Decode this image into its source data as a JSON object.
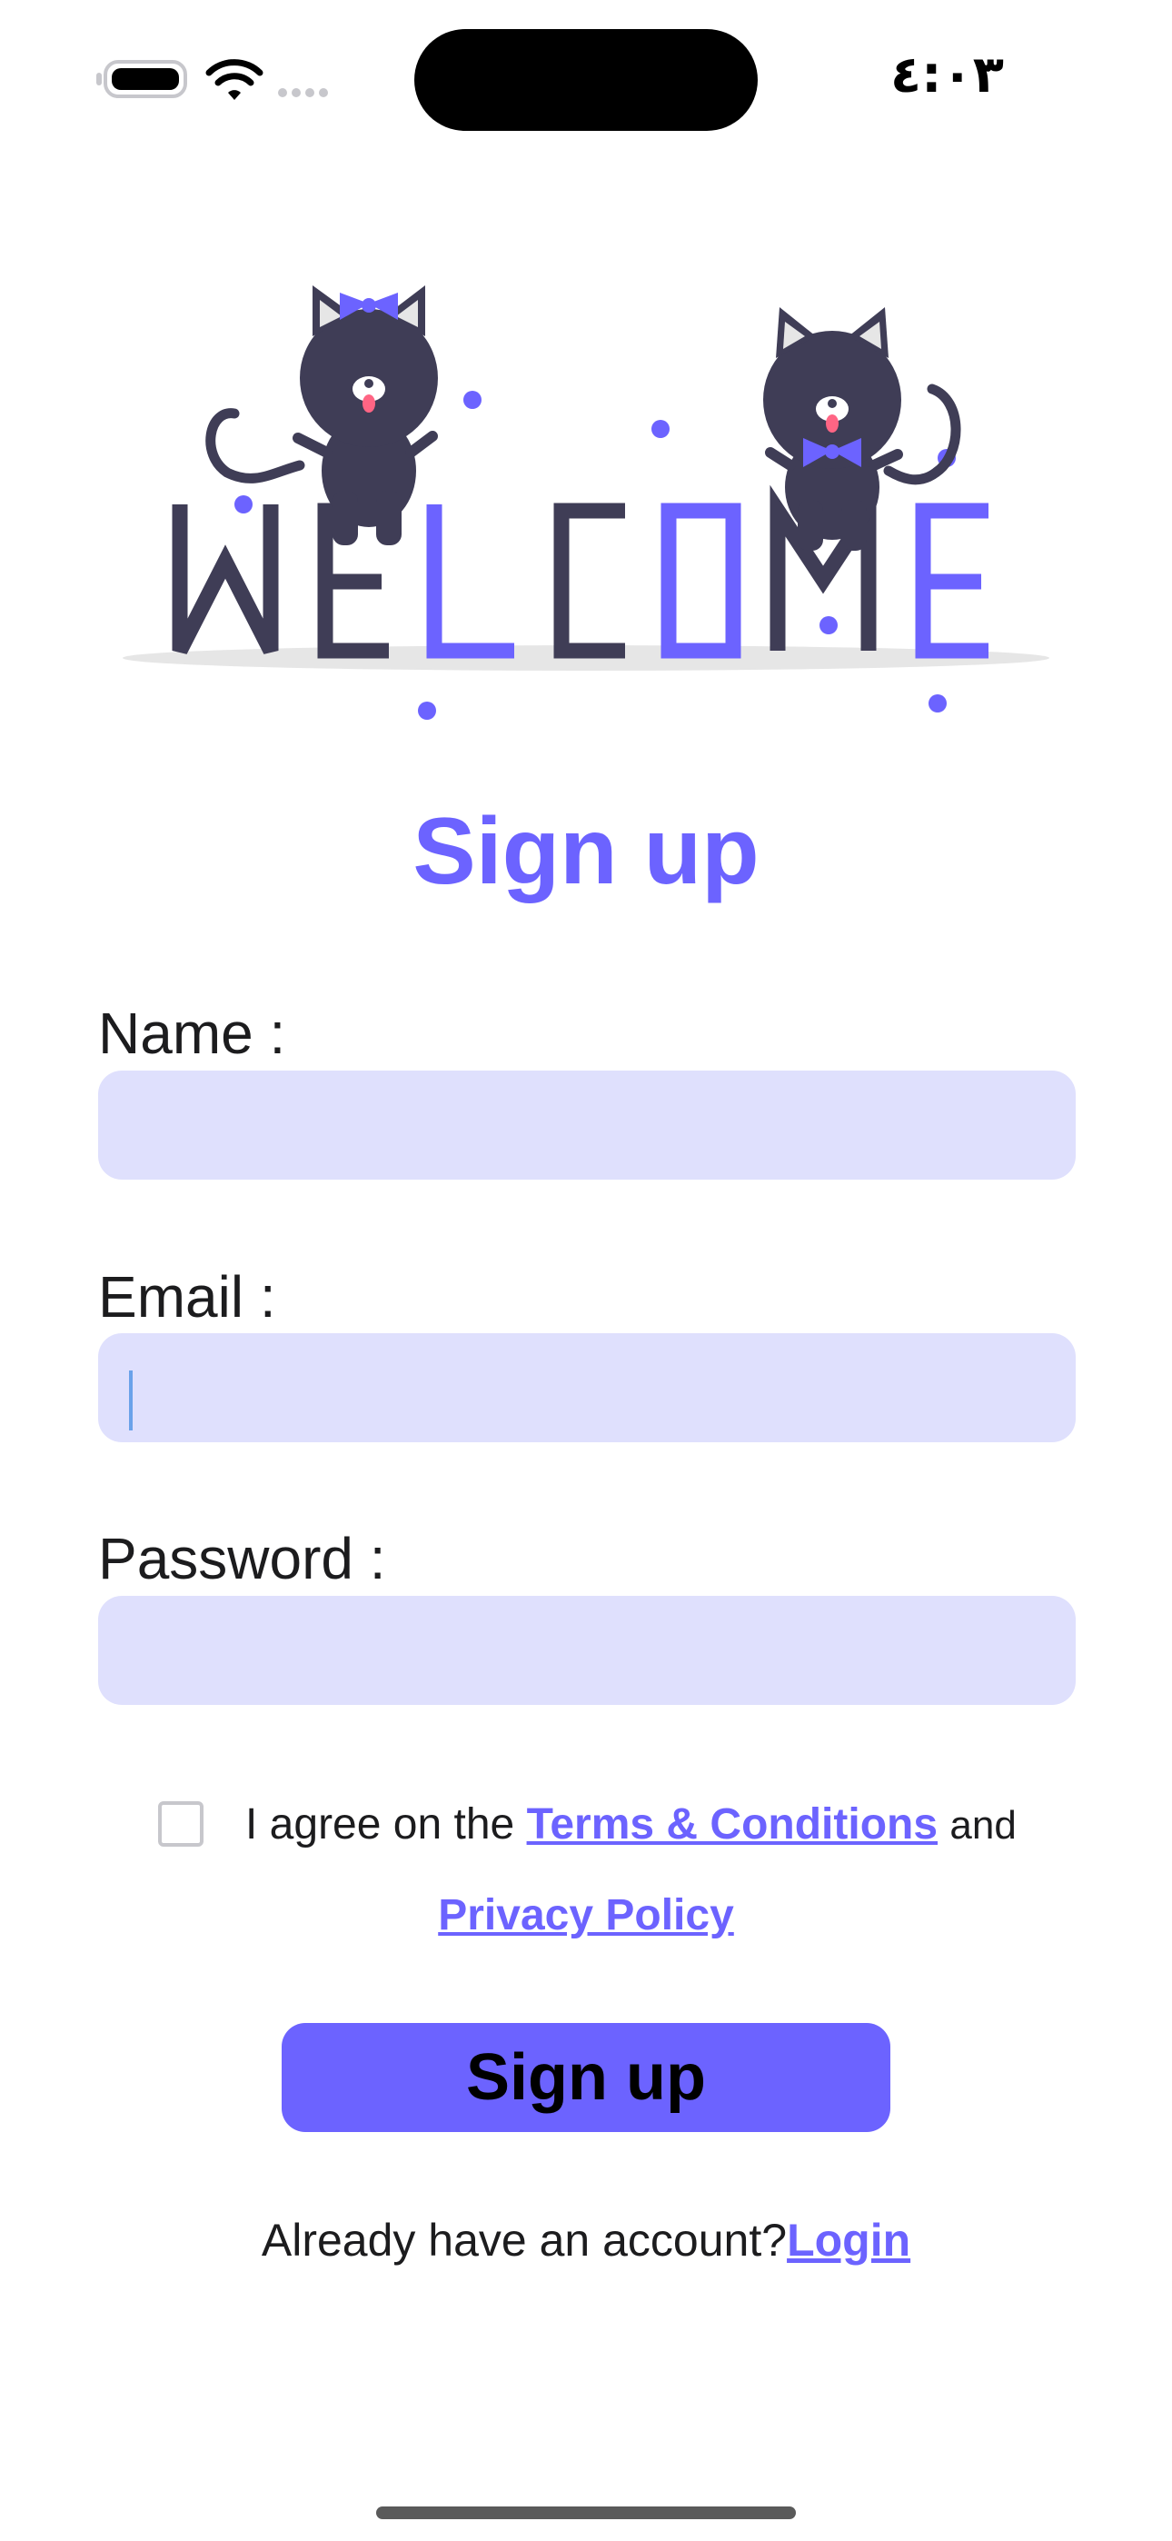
{
  "status_bar": {
    "time": "٤:٠٣",
    "icons": [
      "battery-icon",
      "wifi-icon",
      "cellular-icon"
    ]
  },
  "hero": {
    "illustration": "welcome-cats-illustration",
    "welcome_letters": [
      "W",
      "E",
      "L",
      "C",
      "O",
      "M",
      "E"
    ]
  },
  "page": {
    "title": "Sign up"
  },
  "form": {
    "name_label": "Name :",
    "name_value": "",
    "email_label": "Email :",
    "email_value": "",
    "password_label": "Password :",
    "password_value": ""
  },
  "terms": {
    "prefix": "I agree on the",
    "terms_link": "Terms & Conditions",
    "and_text": "and",
    "privacy_link": "Privacy Policy"
  },
  "actions": {
    "signup_label": "Sign up"
  },
  "footer": {
    "question": "Already have an account?",
    "login_link": "Login"
  },
  "colors": {
    "accent": "#6c63ff",
    "field_bg": "#dfe0fd",
    "dark": "#3f3d56"
  }
}
